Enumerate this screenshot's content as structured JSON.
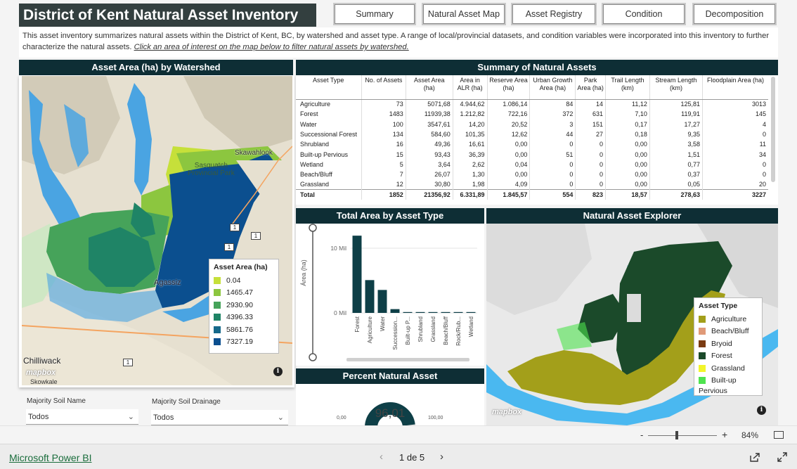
{
  "header": {
    "title": "District of Kent Natural Asset Inventory"
  },
  "tabs": [
    {
      "label": "Summary"
    },
    {
      "label": "Natural Asset Map"
    },
    {
      "label": "Asset Registry"
    },
    {
      "label": "Condition"
    },
    {
      "label": "Decomposition"
    }
  ],
  "intro": {
    "text": "This asset inventory summarizes natural assets within the District of Kent, BC, by watershed and asset type. A range of local/provincial datasets, and condition variables were incorporated into this inventory to further characterize the natural assets.",
    "link": "Click an area of interest on the map below to filter natural assets by watershed."
  },
  "watershed_map": {
    "title": "Asset Area (ha) by Watershed",
    "places": {
      "skawahlook": "Skawahlook",
      "sasquatch": "Sasquatch\nProvincial Park",
      "agassiz": "Agassiz",
      "chilliwack": "Chilliwack",
      "skowkale": "Skowkale"
    },
    "highway_shields": [
      "1",
      "1",
      "1",
      "1"
    ],
    "legend": {
      "title": "Asset Area (ha)",
      "items": [
        {
          "label": "0.04",
          "color": "#c6e03a"
        },
        {
          "label": "1465.47",
          "color": "#8cc63f"
        },
        {
          "label": "2930.90",
          "color": "#46a35a"
        },
        {
          "label": "4396.33",
          "color": "#1f8466"
        },
        {
          "label": "5861.76",
          "color": "#16698a"
        },
        {
          "label": "7327.19",
          "color": "#0b4f8f"
        }
      ]
    },
    "mapbox": "mapbox"
  },
  "summary": {
    "title": "Summary of Natural Assets",
    "columns": [
      "Asset Type",
      "No. of Assets",
      "Asset Area (ha)",
      "Area in ALR (ha)",
      "Reserve Area (ha)",
      "Urban Growth Area (ha)",
      "Park Area (ha)",
      "Trail Length (km)",
      "Stream Length (km)",
      "Floodplain Area (ha)"
    ],
    "rows": [
      [
        "Agriculture",
        "73",
        "5071,68",
        "4.944,62",
        "1.086,14",
        "84",
        "14",
        "11,12",
        "125,81",
        "3013"
      ],
      [
        "Forest",
        "1483",
        "11939,38",
        "1.212,82",
        "722,16",
        "372",
        "631",
        "7,10",
        "119,91",
        "145"
      ],
      [
        "Water",
        "100",
        "3547,61",
        "14,20",
        "20,52",
        "3",
        "151",
        "0,17",
        "17,27",
        "4"
      ],
      [
        "Successional Forest",
        "134",
        "584,60",
        "101,35",
        "12,62",
        "44",
        "27",
        "0,18",
        "9,35",
        "0"
      ],
      [
        "Shrubland",
        "16",
        "49,36",
        "16,61",
        "0,00",
        "0",
        "0",
        "0,00",
        "3,58",
        "11"
      ],
      [
        "Built-up Pervious",
        "15",
        "93,43",
        "36,39",
        "0,00",
        "51",
        "0",
        "0,00",
        "1,51",
        "34"
      ],
      [
        "Wetland",
        "5",
        "3,64",
        "2,62",
        "0,04",
        "0",
        "0",
        "0,00",
        "0,77",
        "0"
      ],
      [
        "Beach/Bluff",
        "7",
        "26,07",
        "1,30",
        "0,00",
        "0",
        "0",
        "0,00",
        "0,37",
        "0"
      ],
      [
        "Grassland",
        "12",
        "30,80",
        "1,98",
        "4,09",
        "0",
        "0",
        "0,00",
        "0,05",
        "20"
      ]
    ],
    "total": [
      "Total",
      "1852",
      "21356,92",
      "6.331,89",
      "1.845,57",
      "554",
      "823",
      "18,57",
      "278,63",
      "3227"
    ]
  },
  "total_area": {
    "title": "Total Area by Asset Type",
    "ylabel": "Área (ha)"
  },
  "chart_data": {
    "type": "bar",
    "title": "Total Area by Asset Type",
    "ylabel": "Área (ha)",
    "xlabel": "",
    "categories": [
      "Forest",
      "Agriculture",
      "Water",
      "Succession...",
      "Built-up P...",
      "Shrubland",
      "Grassland",
      "Beach/Bluff",
      "Rock/Rub...",
      "Wetland"
    ],
    "values": [
      11939380,
      5071680,
      3547610,
      584600,
      93430,
      49360,
      30800,
      26070,
      10000,
      3640
    ],
    "yticks": [
      "10 Mil",
      "0 Mil"
    ],
    "ylim": [
      0,
      12500000
    ],
    "color": "#0e3f47",
    "grid": true
  },
  "percent_natural": {
    "title": "Percent Natural Asset",
    "value": "96,01",
    "value_num": 96.01,
    "min": "0,00",
    "max": "100,00"
  },
  "explorer": {
    "title": "Natural Asset Explorer",
    "legend": {
      "title": "Asset Type",
      "items": [
        {
          "label": "Agriculture",
          "color": "#a39f1a"
        },
        {
          "label": "Beach/Bluff",
          "color": "#e09a78"
        },
        {
          "label": "Bryoid",
          "color": "#7a3b12"
        },
        {
          "label": "Forest",
          "color": "#1b4a2a"
        },
        {
          "label": "Grassland",
          "color": "#f2f52a"
        },
        {
          "label": "Built-up",
          "color": "#4fe34f"
        },
        {
          "label": "Pervious",
          "color": ""
        }
      ]
    },
    "mapbox": "mapbox"
  },
  "filters": {
    "soil_name_label": "Majority Soil Name",
    "soil_name_value": "Todos",
    "soil_drainage_label": "Majority Soil Drainage",
    "soil_drainage_value": "Todos"
  },
  "zoom": {
    "minus": "-",
    "plus": "+",
    "level": "84%"
  },
  "footer": {
    "brand": "Microsoft Power BI",
    "page": "1 de 5"
  }
}
